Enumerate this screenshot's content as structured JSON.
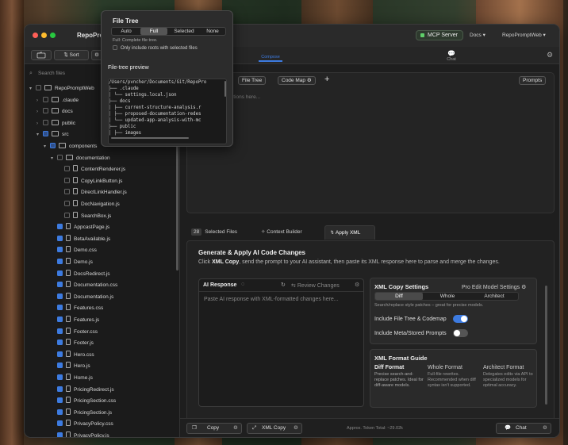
{
  "window": {
    "title": "RepoProm"
  },
  "header": {
    "mcp_label": "MCP Server",
    "docs_label": "Docs ▾",
    "workspace_label": "RepoPromptWeb ▾",
    "compose_label": "Compose",
    "chat_label": "Chat"
  },
  "sidebar": {
    "sort_label": "Sort",
    "search_placeholder": "Search files",
    "root_label": "RepoPromptWeb",
    "items": [
      {
        "label": ".claude",
        "type": "folder",
        "indent": 1,
        "expanded": false,
        "checked": "off"
      },
      {
        "label": "docs",
        "type": "folder",
        "indent": 1,
        "expanded": false,
        "checked": "off"
      },
      {
        "label": "public",
        "type": "folder",
        "indent": 1,
        "expanded": false,
        "checked": "off"
      },
      {
        "label": "src",
        "type": "folder",
        "indent": 1,
        "expanded": true,
        "checked": "mixed"
      },
      {
        "label": "components",
        "type": "folder",
        "indent": 2,
        "expanded": true,
        "checked": "mixed"
      },
      {
        "label": "documentation",
        "type": "folder",
        "indent": 3,
        "expanded": true,
        "checked": "off"
      },
      {
        "label": "ContentRenderer.js",
        "type": "file",
        "indent": 4,
        "checked": "off"
      },
      {
        "label": "CopyLinkButton.js",
        "type": "file",
        "indent": 4,
        "checked": "off"
      },
      {
        "label": "DirectLinkHandler.js",
        "type": "file",
        "indent": 4,
        "checked": "off"
      },
      {
        "label": "DocNavigation.js",
        "type": "file",
        "indent": 4,
        "checked": "off"
      },
      {
        "label": "SearchBox.js",
        "type": "file",
        "indent": 4,
        "checked": "off"
      },
      {
        "label": "AppcastPage.js",
        "type": "file",
        "indent": 3,
        "checked": "on"
      },
      {
        "label": "BetaAvailable.js",
        "type": "file",
        "indent": 3,
        "checked": "on"
      },
      {
        "label": "Demo.css",
        "type": "file",
        "indent": 3,
        "checked": "on"
      },
      {
        "label": "Demo.js",
        "type": "file",
        "indent": 3,
        "checked": "on"
      },
      {
        "label": "DocsRedirect.js",
        "type": "file",
        "indent": 3,
        "checked": "on"
      },
      {
        "label": "Documentation.css",
        "type": "file",
        "indent": 3,
        "checked": "on"
      },
      {
        "label": "Documentation.js",
        "type": "file",
        "indent": 3,
        "checked": "on"
      },
      {
        "label": "Features.css",
        "type": "file",
        "indent": 3,
        "checked": "on"
      },
      {
        "label": "Features.js",
        "type": "file",
        "indent": 3,
        "checked": "on"
      },
      {
        "label": "Footer.css",
        "type": "file",
        "indent": 3,
        "checked": "on"
      },
      {
        "label": "Footer.js",
        "type": "file",
        "indent": 3,
        "checked": "on"
      },
      {
        "label": "Hero.css",
        "type": "file",
        "indent": 3,
        "checked": "on"
      },
      {
        "label": "Hero.js",
        "type": "file",
        "indent": 3,
        "checked": "on"
      },
      {
        "label": "Home.js",
        "type": "file",
        "indent": 3,
        "checked": "on"
      },
      {
        "label": "PricingRedirect.js",
        "type": "file",
        "indent": 3,
        "checked": "on"
      },
      {
        "label": "PricingSection.css",
        "type": "file",
        "indent": 3,
        "checked": "on"
      },
      {
        "label": "PricingSection.js",
        "type": "file",
        "indent": 3,
        "checked": "on"
      },
      {
        "label": "PrivacyPolicy.css",
        "type": "file",
        "indent": 3,
        "checked": "on"
      },
      {
        "label": "PrivacyPolicy.js",
        "type": "file",
        "indent": 3,
        "checked": "on"
      }
    ]
  },
  "prompt": {
    "file_tree_chip": "File Tree",
    "code_map_chip": "Code Map",
    "add_label": "+",
    "prompts_button": "Prompts",
    "placeholder": "ctions here..."
  },
  "tabs": {
    "selected_count": "28",
    "selected_files": "Selected Files",
    "context_builder": "Context Builder",
    "apply_xml": "Apply XML"
  },
  "apply": {
    "heading": "Generate & Apply AI Code Changes",
    "desc_prefix": "Click ",
    "desc_bold": "XML Copy",
    "desc_suffix": ", send the prompt to your AI assistant, then paste its XML response here to parse and merge the changes.",
    "ai_response_label": "AI Response",
    "review_changes": "Review Changes",
    "ai_placeholder": "Paste AI response with XML-formatted changes here...",
    "xml_settings_title": "XML Copy Settings",
    "pro_edit_label": "Pro Edit Model Settings",
    "modes": [
      "Diff",
      "Whole",
      "Architect"
    ],
    "mode_desc": "Search/replace style patches – great for precise models.",
    "include_tree_label": "Include File Tree & Codemap",
    "include_tree_on": true,
    "include_meta_label": "Include Meta/Stored Prompts",
    "include_meta_on": false,
    "guide_title": "XML Format Guide",
    "guide_cols": [
      {
        "title": "Diff Format",
        "text": "Precise search-and-replace patches. Ideal for diff-aware models."
      },
      {
        "title": "Whole Format",
        "text": "Full-file rewrites. Recommended when diff syntax isn't supported."
      },
      {
        "title": "Architect Format",
        "text": "Delegates edits via API to specialized models for optimal accuracy."
      }
    ]
  },
  "bottom": {
    "copy_label": "Copy",
    "xml_copy_label": "XML Copy",
    "token_total": "Approx. Token Total: ~29.02k",
    "chat_label": "Chat"
  },
  "popover": {
    "title": "File Tree",
    "modes": [
      "Auto",
      "Full",
      "Selected",
      "None"
    ],
    "active_mode": "Full",
    "mode_desc": "Full: Complete file tree.",
    "only_roots_label": "Only include roots with selected files",
    "preview_title": "File-tree preview",
    "preview_lines": [
      "/Users/pvncher/Documents/Git/RepoPro",
      "├── .claude",
      "│   └── settings.local.json",
      "├── docs",
      "│   ├── current-structure-analysis.r",
      "│   ├── proposed-documentation-redes",
      "│   └── updated-app-analysis-with-mc",
      "├── public",
      "│   ├── images"
    ]
  },
  "colors": {
    "accent": "#3d7be0",
    "mcp_dot": "#5fd16a"
  }
}
